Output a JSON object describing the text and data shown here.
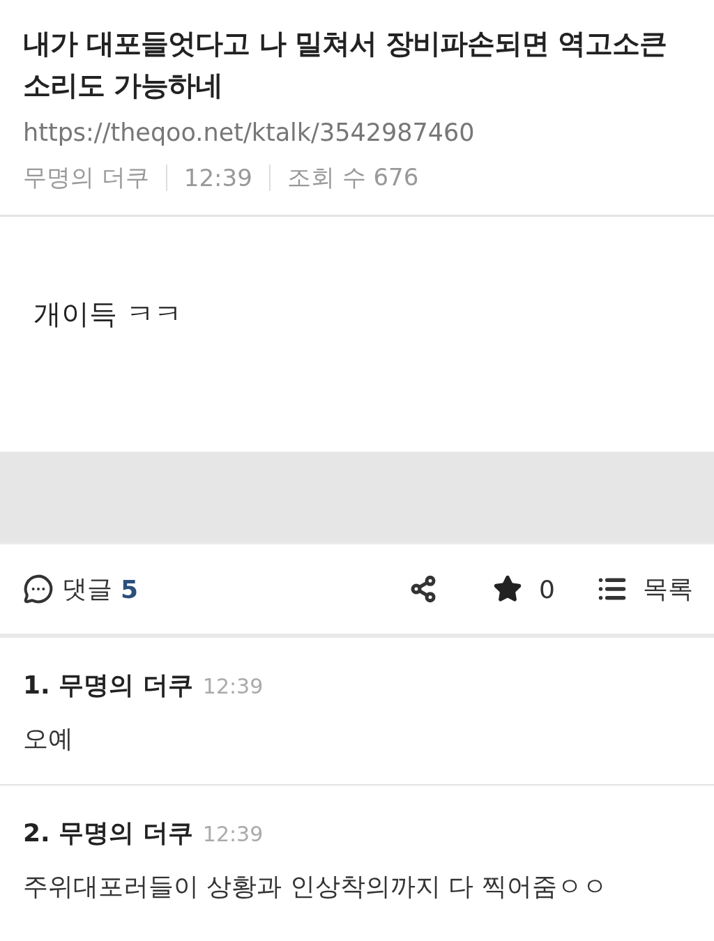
{
  "post": {
    "title": "내가 대포들엇다고 나 밀쳐서 장비파손되면 역고소큰소리도 가능하네",
    "url": "https://theqoo.net/ktalk/3542987460",
    "author": "무명의 더쿠",
    "time": "12:39",
    "views": "조회 수 676"
  },
  "content": "개이득 ㅋㅋ",
  "actions": {
    "comments_label": "댓글",
    "comments_count": "5",
    "favorite_count": "0",
    "list_label": "목록"
  },
  "comments": [
    {
      "number": "1.",
      "author": "무명의 더쿠",
      "time": "12:39",
      "text": "오예"
    },
    {
      "number": "2.",
      "author": "무명의 더쿠",
      "time": "12:39",
      "text": "주위대포러들이 상황과 인상착의까지 다 찍어줌ㅇㅇ"
    }
  ]
}
